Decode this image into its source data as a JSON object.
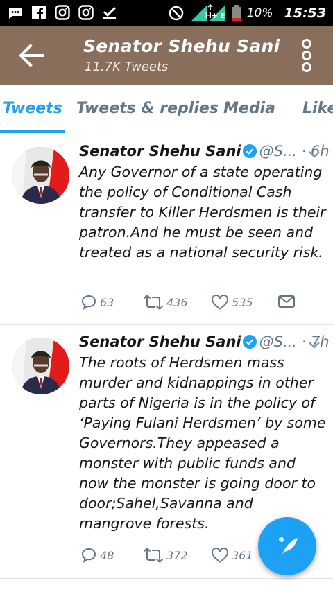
{
  "status_bar": {
    "battery_percent": "10%",
    "time": "15:53",
    "network_label": "H+",
    "network_label_2": "E"
  },
  "header": {
    "title": "Senator Shehu Sani",
    "subtitle": "11.7K Tweets"
  },
  "tabs": [
    {
      "label": "Tweets",
      "active": true
    },
    {
      "label": "Tweets & replies",
      "active": false
    },
    {
      "label": "Media",
      "active": false
    },
    {
      "label": "Likes",
      "active": false
    }
  ],
  "tweets": [
    {
      "name": "Senator Shehu Sani",
      "handle": "@S...",
      "time": "· 6h",
      "text": "Any Governor of a state operating the policy of Conditional Cash transfer to Killer Herdsmen is their patron.And he must be seen and treated as a national security risk.",
      "replies": "63",
      "retweets": "436",
      "likes": "535"
    },
    {
      "name": "Senator Shehu Sani",
      "handle": "@S...",
      "time": "· 7h",
      "text": "The roots of Herdsmen mass murder and kidnappings in other parts of Nigeria is in the policy of ‘Paying Fulani Herdsmen’ by some Governors.They appeased a monster with public funds and now the monster is going door to door;Sahel,Savanna and mangrove forests.",
      "replies": "48",
      "retweets": "372",
      "likes": "361"
    }
  ],
  "colors": {
    "header_bg": "#8a6e5c",
    "accent": "#1da1f2",
    "muted": "#657786"
  },
  "icons": [
    "whatsapp-icon",
    "facebook-icon",
    "instagram-icon",
    "instagram-icon",
    "download-check-icon",
    "no-disturb-icon",
    "signal-icon",
    "battery-icon",
    "back-arrow-icon",
    "more-vert-icon",
    "verified-icon",
    "chevron-down-icon",
    "reply-icon",
    "retweet-icon",
    "like-icon",
    "dm-icon",
    "compose-icon"
  ]
}
